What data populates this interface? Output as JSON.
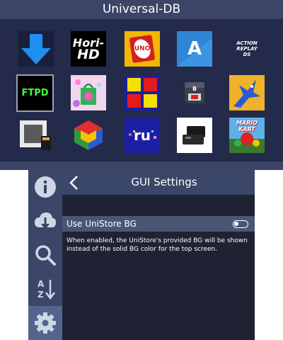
{
  "top_screen": {
    "title": "Universal-DB",
    "apps": [
      {
        "name": "download-arrow-app-icon"
      },
      {
        "name": "hori-hd-app-icon",
        "text_line1": "Hori-",
        "text_line2": "HD"
      },
      {
        "name": "uno-app-icon",
        "text": "UNO"
      },
      {
        "name": "a-letter-app-icon",
        "text": "A"
      },
      {
        "name": "action-replay-app-icon",
        "text_line1": "ACTION",
        "text_line2": "REPLAY",
        "text_line3": "DS"
      },
      {
        "name": "ftpd-app-icon",
        "text": "FTPD"
      },
      {
        "name": "shopping-bag-app-icon"
      },
      {
        "name": "four-squares-app-icon"
      },
      {
        "name": "game-card-app-icon",
        "text": "B"
      },
      {
        "name": "blue-creature-app-icon"
      },
      {
        "name": "console-sd-card-app-icon"
      },
      {
        "name": "n64-cube-app-icon"
      },
      {
        "name": "ru-app-icon",
        "text": "ru"
      },
      {
        "name": "black-console-app-icon"
      },
      {
        "name": "mario-kart-app-icon",
        "text": "MARIO KART"
      }
    ]
  },
  "bottom_screen": {
    "sidebar": [
      {
        "name": "info-icon"
      },
      {
        "name": "cloud-download-icon"
      },
      {
        "name": "search-icon"
      },
      {
        "name": "sort-az-icon",
        "text_a": "A",
        "text_z": "Z"
      },
      {
        "name": "settings-gear-icon"
      }
    ],
    "panel_title": "GUI Settings",
    "option": {
      "label": "Use UniStore BG",
      "enabled": false,
      "description": "When enabled, the UniStore's provided BG will be shown instead of the solid BG color for the top screen."
    }
  },
  "colors": {
    "top_bg": "#232a4a",
    "bar": "#3d4566",
    "sidebar": "#3a4768",
    "sidebar_selected": "#54658b",
    "panel_bg": "#1e2232",
    "option_row": "#4b5675"
  }
}
